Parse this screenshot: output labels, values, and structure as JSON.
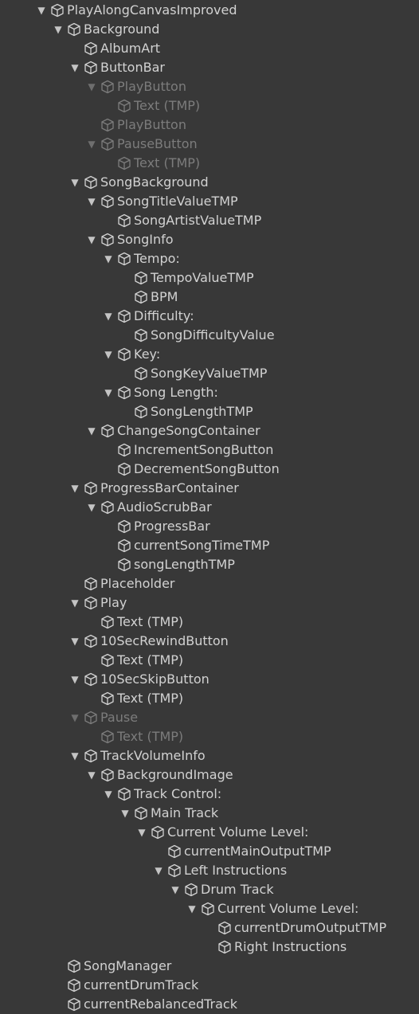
{
  "hierarchy": {
    "items": [
      {
        "label": "PlayAlongCanvasImproved",
        "depth": 0,
        "expanded": true,
        "enabled": true,
        "icon": "gameobject-cube-icon"
      },
      {
        "label": "Background",
        "depth": 1,
        "expanded": true,
        "enabled": true,
        "icon": "gameobject-cube-icon"
      },
      {
        "label": "AlbumArt",
        "depth": 2,
        "expanded": null,
        "enabled": true,
        "icon": "gameobject-cube-icon"
      },
      {
        "label": "ButtonBar",
        "depth": 2,
        "expanded": true,
        "enabled": true,
        "icon": "gameobject-cube-icon"
      },
      {
        "label": "PlayButton",
        "depth": 3,
        "expanded": true,
        "enabled": false,
        "icon": "gameobject-cube-icon"
      },
      {
        "label": "Text (TMP)",
        "depth": 4,
        "expanded": null,
        "enabled": false,
        "icon": "gameobject-cube-icon"
      },
      {
        "label": "PlayButton",
        "depth": 3,
        "expanded": null,
        "enabled": false,
        "icon": "gameobject-cube-icon"
      },
      {
        "label": "PauseButton",
        "depth": 3,
        "expanded": true,
        "enabled": false,
        "icon": "gameobject-cube-icon"
      },
      {
        "label": "Text (TMP)",
        "depth": 4,
        "expanded": null,
        "enabled": false,
        "icon": "gameobject-cube-icon"
      },
      {
        "label": "SongBackground",
        "depth": 2,
        "expanded": true,
        "enabled": true,
        "icon": "gameobject-cube-icon"
      },
      {
        "label": "SongTitleValueTMP",
        "depth": 3,
        "expanded": true,
        "enabled": true,
        "icon": "gameobject-cube-icon"
      },
      {
        "label": "SongArtistValueTMP",
        "depth": 4,
        "expanded": null,
        "enabled": true,
        "icon": "gameobject-cube-icon"
      },
      {
        "label": "SongInfo",
        "depth": 3,
        "expanded": true,
        "enabled": true,
        "icon": "gameobject-cube-icon"
      },
      {
        "label": "Tempo:",
        "depth": 4,
        "expanded": true,
        "enabled": true,
        "icon": "gameobject-cube-icon"
      },
      {
        "label": "TempoValueTMP",
        "depth": 5,
        "expanded": null,
        "enabled": true,
        "icon": "gameobject-cube-icon"
      },
      {
        "label": "BPM",
        "depth": 5,
        "expanded": null,
        "enabled": true,
        "icon": "gameobject-cube-icon"
      },
      {
        "label": "Difficulty:",
        "depth": 4,
        "expanded": true,
        "enabled": true,
        "icon": "gameobject-cube-icon"
      },
      {
        "label": "SongDifficultyValue",
        "depth": 5,
        "expanded": null,
        "enabled": true,
        "icon": "gameobject-cube-icon"
      },
      {
        "label": "Key:",
        "depth": 4,
        "expanded": true,
        "enabled": true,
        "icon": "gameobject-cube-icon"
      },
      {
        "label": "SongKeyValueTMP",
        "depth": 5,
        "expanded": null,
        "enabled": true,
        "icon": "gameobject-cube-icon"
      },
      {
        "label": "Song Length:",
        "depth": 4,
        "expanded": true,
        "enabled": true,
        "icon": "gameobject-cube-icon"
      },
      {
        "label": "SongLengthTMP",
        "depth": 5,
        "expanded": null,
        "enabled": true,
        "icon": "gameobject-cube-icon"
      },
      {
        "label": "ChangeSongContainer",
        "depth": 3,
        "expanded": true,
        "enabled": true,
        "icon": "gameobject-cube-icon"
      },
      {
        "label": "IncrementSongButton",
        "depth": 4,
        "expanded": null,
        "enabled": true,
        "icon": "gameobject-cube-icon"
      },
      {
        "label": "DecrementSongButton",
        "depth": 4,
        "expanded": null,
        "enabled": true,
        "icon": "gameobject-cube-icon"
      },
      {
        "label": "ProgressBarContainer",
        "depth": 2,
        "expanded": true,
        "enabled": true,
        "icon": "gameobject-cube-icon"
      },
      {
        "label": "AudioScrubBar",
        "depth": 3,
        "expanded": true,
        "enabled": true,
        "icon": "gameobject-cube-icon"
      },
      {
        "label": "ProgressBar",
        "depth": 4,
        "expanded": null,
        "enabled": true,
        "icon": "gameobject-cube-icon"
      },
      {
        "label": "currentSongTimeTMP",
        "depth": 4,
        "expanded": null,
        "enabled": true,
        "icon": "gameobject-cube-icon"
      },
      {
        "label": "songLengthTMP",
        "depth": 4,
        "expanded": null,
        "enabled": true,
        "icon": "gameobject-cube-icon"
      },
      {
        "label": "Placeholder",
        "depth": 2,
        "expanded": null,
        "enabled": true,
        "icon": "gameobject-cube-icon"
      },
      {
        "label": "Play",
        "depth": 2,
        "expanded": true,
        "enabled": true,
        "icon": "gameobject-cube-icon"
      },
      {
        "label": "Text (TMP)",
        "depth": 3,
        "expanded": null,
        "enabled": true,
        "icon": "gameobject-cube-icon"
      },
      {
        "label": "10SecRewindButton",
        "depth": 2,
        "expanded": true,
        "enabled": true,
        "icon": "gameobject-cube-icon"
      },
      {
        "label": "Text (TMP)",
        "depth": 3,
        "expanded": null,
        "enabled": true,
        "icon": "gameobject-cube-icon"
      },
      {
        "label": "10SecSkipButton",
        "depth": 2,
        "expanded": true,
        "enabled": true,
        "icon": "gameobject-cube-icon"
      },
      {
        "label": "Text (TMP)",
        "depth": 3,
        "expanded": null,
        "enabled": true,
        "icon": "gameobject-cube-icon"
      },
      {
        "label": "Pause",
        "depth": 2,
        "expanded": true,
        "enabled": false,
        "icon": "gameobject-cube-icon"
      },
      {
        "label": "Text (TMP)",
        "depth": 3,
        "expanded": null,
        "enabled": false,
        "icon": "gameobject-cube-icon"
      },
      {
        "label": "TrackVolumeInfo",
        "depth": 2,
        "expanded": true,
        "enabled": true,
        "icon": "gameobject-cube-icon"
      },
      {
        "label": "BackgroundImage",
        "depth": 3,
        "expanded": true,
        "enabled": true,
        "icon": "gameobject-cube-icon"
      },
      {
        "label": "Track Control:",
        "depth": 4,
        "expanded": true,
        "enabled": true,
        "icon": "gameobject-cube-icon"
      },
      {
        "label": "Main Track",
        "depth": 5,
        "expanded": true,
        "enabled": true,
        "icon": "gameobject-cube-icon"
      },
      {
        "label": "Current Volume Level:",
        "depth": 6,
        "expanded": true,
        "enabled": true,
        "icon": "gameobject-cube-icon"
      },
      {
        "label": "currentMainOutputTMP",
        "depth": 7,
        "expanded": null,
        "enabled": true,
        "icon": "gameobject-cube-icon"
      },
      {
        "label": "Left Instructions",
        "depth": 7,
        "expanded": true,
        "enabled": true,
        "icon": "gameobject-cube-icon"
      },
      {
        "label": "Drum Track",
        "depth": 8,
        "expanded": true,
        "enabled": true,
        "icon": "gameobject-cube-icon"
      },
      {
        "label": "Current Volume Level:",
        "depth": 9,
        "expanded": true,
        "enabled": true,
        "icon": "gameobject-cube-icon"
      },
      {
        "label": "currentDrumOutputTMP",
        "depth": 10,
        "expanded": null,
        "enabled": true,
        "icon": "gameobject-cube-icon"
      },
      {
        "label": "Right Instructions",
        "depth": 10,
        "expanded": null,
        "enabled": true,
        "icon": "gameobject-cube-icon"
      },
      {
        "label": "SongManager",
        "depth": 1,
        "expanded": null,
        "enabled": true,
        "icon": "gameobject-cube-icon"
      },
      {
        "label": "currentDrumTrack",
        "depth": 1,
        "expanded": null,
        "enabled": true,
        "icon": "gameobject-cube-icon"
      },
      {
        "label": "currentRebalancedTrack",
        "depth": 1,
        "expanded": null,
        "enabled": true,
        "icon": "gameobject-cube-icon"
      }
    ]
  },
  "colors": {
    "background": "#383838",
    "text": "#d2d2d2",
    "text_disabled": "#7c7c7c"
  }
}
